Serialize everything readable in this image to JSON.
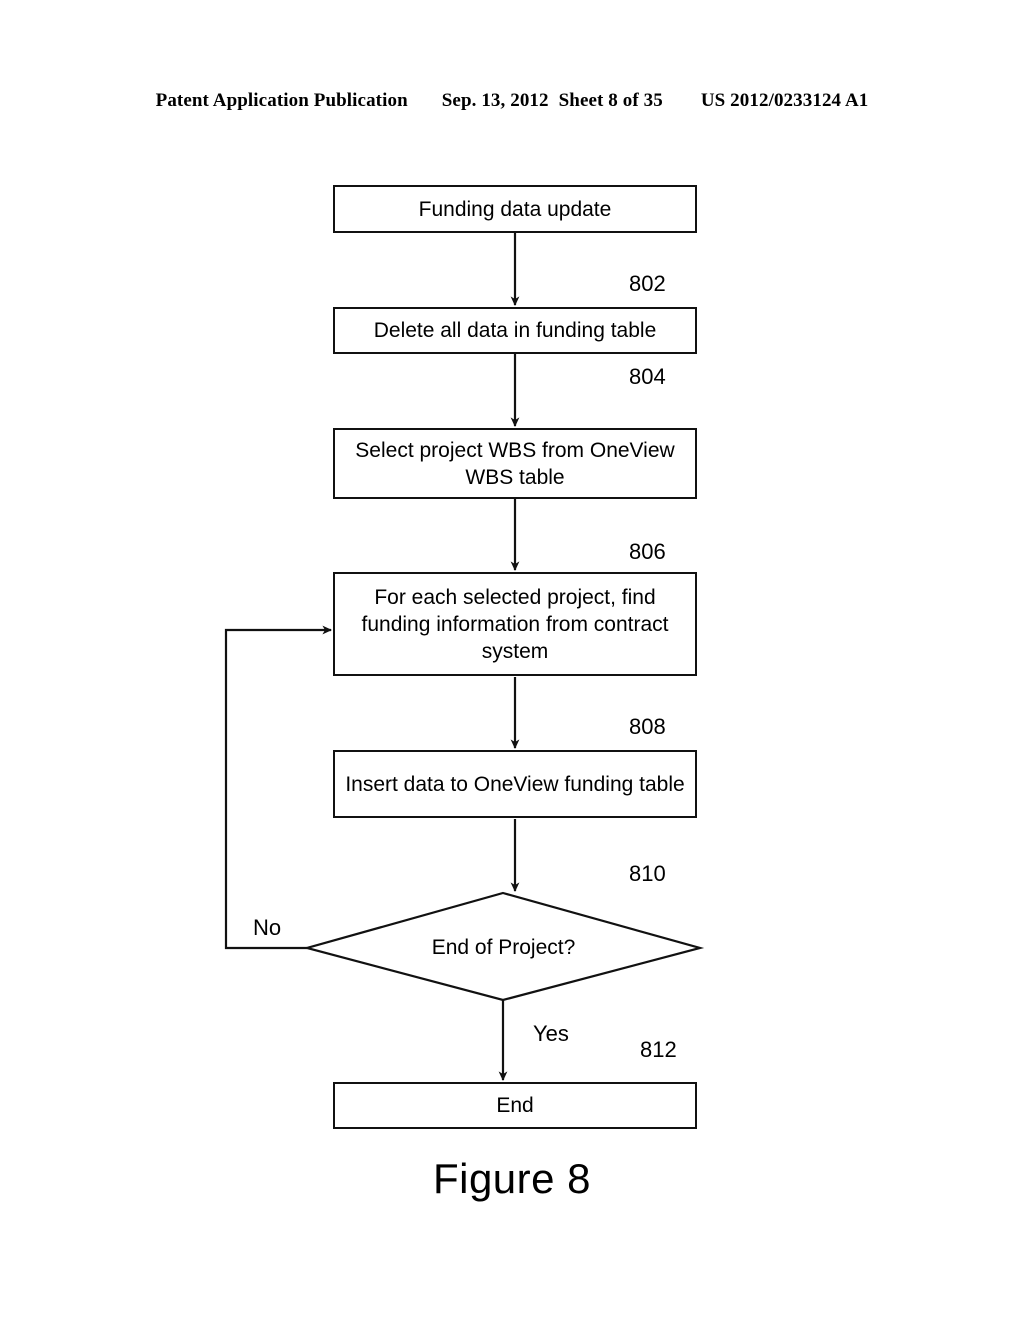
{
  "page_header": {
    "publication": "Patent Application Publication",
    "date": "Sep. 13, 2012",
    "sheet": "Sheet 8 of 35",
    "patent_number": "US 2012/0233124 A1"
  },
  "figure": {
    "caption": "Figure 8"
  },
  "flowchart": {
    "nodes": [
      {
        "id": "start",
        "label": "Funding data update",
        "shape": "process"
      },
      {
        "id": "delete",
        "label": "Delete all data in funding table",
        "shape": "process"
      },
      {
        "id": "select",
        "label": "Select project WBS from OneView WBS table",
        "shape": "process"
      },
      {
        "id": "foreach",
        "label": "For each selected project, find funding information from contract system",
        "shape": "process"
      },
      {
        "id": "insert",
        "label": "Insert data to OneView funding table",
        "shape": "process"
      },
      {
        "id": "decide",
        "label": "End of Project?",
        "shape": "decision"
      },
      {
        "id": "end",
        "label": "End",
        "shape": "process"
      }
    ],
    "reference_numerals": {
      "n802": "802",
      "n804": "804",
      "n806": "806",
      "n808": "808",
      "n810": "810",
      "n812": "812"
    },
    "branch_labels": {
      "no": "No",
      "yes": "Yes"
    },
    "colors": {
      "line": "#111111",
      "background": "#ffffff",
      "text": "#000000"
    }
  }
}
